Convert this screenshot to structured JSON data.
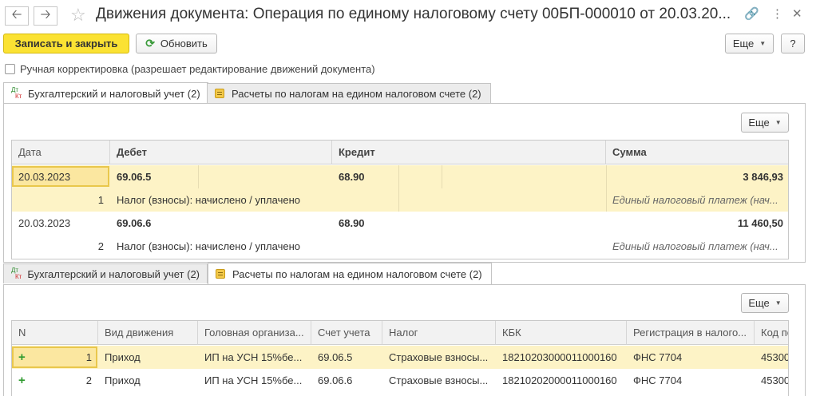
{
  "window": {
    "title": "Движения документа: Операция по единому налоговому счету 00БП-000010 от 20.03.20..."
  },
  "toolbar": {
    "save_close_label": "Записать и закрыть",
    "refresh_label": "Обновить",
    "more_label": "Еще",
    "help_label": "?"
  },
  "manual_edit": {
    "label": "Ручная корректировка (разрешает редактирование движений документа)",
    "checked": false
  },
  "tabs": [
    {
      "label": "Бухгалтерский и налоговый учет (2)",
      "icon": "dt-kt-icon"
    },
    {
      "label": "Расчеты по налогам на едином налоговом счете (2)",
      "icon": "register-icon"
    }
  ],
  "accounting": {
    "more_label": "Еще",
    "columns": [
      "Дата",
      "Дебет",
      "Кредит",
      "Сумма"
    ],
    "rows": [
      {
        "date": "20.03.2023",
        "num": "1",
        "debit": "69.06.5",
        "credit": "68.90",
        "amount": "3 846,93",
        "content": "Налог (взносы): начислено / уплачено",
        "note": "Единый налоговый платеж (нач..."
      },
      {
        "date": "20.03.2023",
        "num": "2",
        "debit": "69.06.6",
        "credit": "68.90",
        "amount": "11 460,50",
        "content": "Налог (взносы): начислено / уплачено",
        "note": "Единый налоговый платеж (нач..."
      }
    ]
  },
  "ens": {
    "more_label": "Еще",
    "columns": [
      "N",
      "Вид движения",
      "Головная организа...",
      "Счет учета",
      "Налог",
      "КБК",
      "Регистрация в налого...",
      "Код по"
    ],
    "rows": [
      {
        "n": "1",
        "kind": "Приход",
        "org": "ИП на УСН 15%бе...",
        "account": "69.06.5",
        "tax": "Страховые взносы...",
        "kbk": "18210203000011000160",
        "reg": "ФНС 7704",
        "code": "45300"
      },
      {
        "n": "2",
        "kind": "Приход",
        "org": "ИП на УСН 15%бе...",
        "account": "69.06.6",
        "tax": "Страховые взносы...",
        "kbk": "18210202000011000160",
        "reg": "ФНС 7704",
        "code": "45300"
      }
    ]
  }
}
